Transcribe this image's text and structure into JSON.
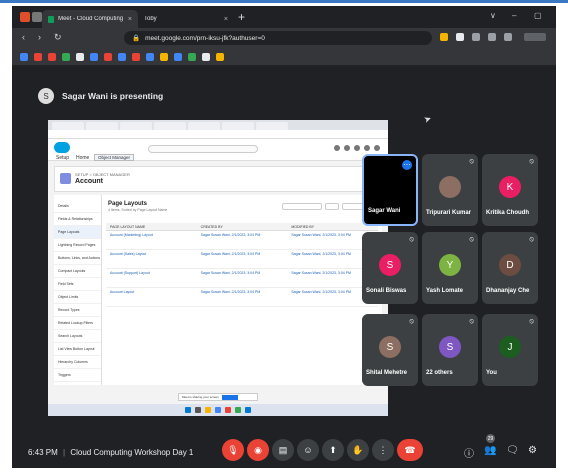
{
  "browser": {
    "tabs": [
      {
        "label": "Meet - Cloud Computing Wo",
        "close": "×"
      },
      {
        "label": "Toby",
        "close": "×"
      }
    ],
    "new_tab": "+",
    "window_controls": [
      "∨",
      "–",
      "▢"
    ],
    "url": "meet.google.com/prn-iksu-jfk?authuser=0"
  },
  "presenting": {
    "text": "Sagar Wani is presenting",
    "avatar_letter": "S"
  },
  "shared_screen": {
    "setup": "Setup",
    "home": "Home",
    "object_manager": "Object Manager",
    "object_sub": "SETUP > OBJECT MANAGER",
    "object_title": "Account",
    "sidebar": [
      "Details",
      "Fields & Relationships",
      "Page Layouts",
      "Lightning Record Pages",
      "Buttons, Links, and Actions",
      "Compact Layouts",
      "Field Sets",
      "Object Limits",
      "Record Types",
      "Related Lookup Filters",
      "Search Layouts",
      "List View Button Layout",
      "Hierarchy Columns",
      "Triggers"
    ],
    "main_title": "Page Layouts",
    "main_sub": "4 Items, Sorted by Page Layout Name",
    "columns": [
      "PAGE LAYOUT NAME",
      "CREATED BY",
      "MODIFIED BY"
    ],
    "rows": [
      [
        "Account (Marketing) Layout",
        "Sagar Susan Wani, 2/1/2023, 3:04 PM",
        "Sagar Susan Wani, 2/1/2023, 3:04 PM"
      ],
      [
        "Account (Sales) Layout",
        "Sagar Susan Wani, 2/1/2023, 3:04 PM",
        "Sagar Susan Wani, 2/1/2023, 3:04 PM"
      ],
      [
        "Account (Support) Layout",
        "Sagar Susan Wani, 2/1/2023, 3:04 PM",
        "Sagar Susan Wani, 2/1/2023, 3:04 PM"
      ],
      [
        "Account Layout",
        "Sagar Susan Wani, 2/1/2023, 3:04 PM",
        "Sagar Susan Wani, 2/1/2023, 3:04 PM"
      ]
    ],
    "banner_text": "Meet is sharing your screen"
  },
  "participants": [
    {
      "name": "Sagar Wani",
      "letter": "",
      "color": "#000000",
      "speaking": true
    },
    {
      "name": "Tripurari Kumar",
      "letter": "",
      "color": "#8d6e63",
      "speaking": false
    },
    {
      "name": "Kritika Choudh",
      "letter": "K",
      "color": "#e91e63",
      "speaking": false
    },
    {
      "name": "Sonali Biswas",
      "letter": "S",
      "color": "#e91e63",
      "speaking": false
    },
    {
      "name": "Yash Lomate",
      "letter": "Y",
      "color": "#7cb342",
      "speaking": false
    },
    {
      "name": "Dhananjay Che",
      "letter": "D",
      "color": "#6d4c41",
      "speaking": false
    },
    {
      "name": "Shital Mehetre",
      "letter": "S",
      "color": "#8d6e63",
      "speaking": false
    },
    {
      "name": "22 others",
      "letter": "S",
      "color": "#7e57c2",
      "speaking": false
    },
    {
      "name": "You",
      "letter": "J",
      "color": "#1b5e20",
      "speaking": false
    }
  ],
  "meeting": {
    "time": "6:43 PM",
    "separator": "|",
    "title": "Cloud Computing Workshop Day 1"
  },
  "controls": {
    "mic": "🎙",
    "cam": "◉",
    "captions": "▤",
    "emoji": "☺",
    "present": "⬆",
    "raise_hand": "✋",
    "more": "⋮",
    "hangup": "☎"
  },
  "right_controls": {
    "info": "ⓘ",
    "people": "👥",
    "chat": "🗨",
    "activities": "⚙",
    "people_count": "29"
  }
}
